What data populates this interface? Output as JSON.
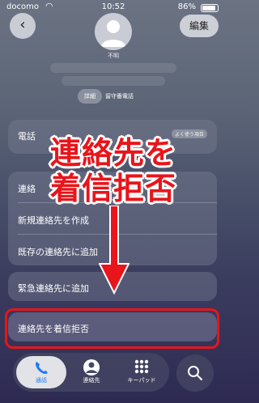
{
  "status_bar": {
    "carrier": "docomo",
    "time": "10:52",
    "battery": "86%"
  },
  "header": {
    "edit_label": "編集",
    "contact_name": "不明"
  },
  "segment": {
    "active": "詳細",
    "other": "留守番電話"
  },
  "phone_card": {
    "label": "電話",
    "pill": "よく使う項目"
  },
  "actions": {
    "header": "連絡",
    "items": [
      "新規連絡先を作成",
      "既存の連絡先に追加"
    ]
  },
  "emergency": {
    "label": "緊急連絡先に追加"
  },
  "block": {
    "label": "連絡先を着信拒否"
  },
  "overlay": {
    "line1": "連絡先を",
    "line2": "着信拒否",
    "color": "#e8151b"
  },
  "tabs": [
    {
      "label": "通話",
      "icon": "phone-icon",
      "active": true
    },
    {
      "label": "連絡先",
      "icon": "person-icon",
      "active": false
    },
    {
      "label": "キーパッド",
      "icon": "keypad-icon",
      "active": false
    }
  ],
  "colors": {
    "accent": "#1a7cf5",
    "highlight": "#e8151b"
  }
}
